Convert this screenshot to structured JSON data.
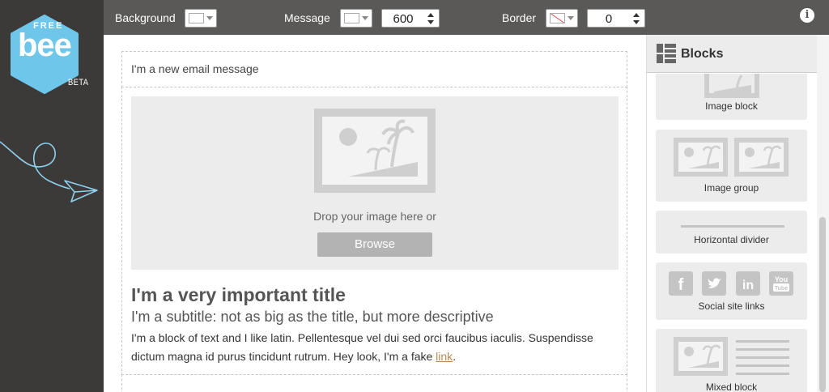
{
  "brand": {
    "free": "FREE",
    "name": "bee",
    "beta": "BETA"
  },
  "toolbar": {
    "background_label": "Background",
    "message_label": "Message",
    "message_width": "600",
    "border_label": "Border",
    "border_width": "0",
    "info_icon": "i"
  },
  "email": {
    "subject": "I'm a new email message",
    "drop_text": "Drop your image here or",
    "browse_label": "Browse",
    "title": "I'm a very important title",
    "subtitle": "I'm a subtitle: not as big as the title, but more descriptive",
    "body_prefix": "I'm a block of text and I like latin. Pellentesque vel dui sed orci faucibus iaculis. Suspendisse dictum magna id purus tincidunt rutrum. Hey look, I'm a fake ",
    "link_text": "link",
    "body_suffix": "."
  },
  "panel": {
    "title": "Blocks",
    "blocks": [
      {
        "label": "Image block"
      },
      {
        "label": "Image group"
      },
      {
        "label": "Horizontal divider"
      },
      {
        "label": "Social site links"
      },
      {
        "label": "Mixed block"
      }
    ],
    "social_icons": [
      "f",
      "t",
      "in",
      "You Tube"
    ]
  },
  "colors": {
    "sidebar": "#3b3a39",
    "toolbar": "#5a5958",
    "logo": "#6ec6ea",
    "link": "#b58a5c"
  }
}
